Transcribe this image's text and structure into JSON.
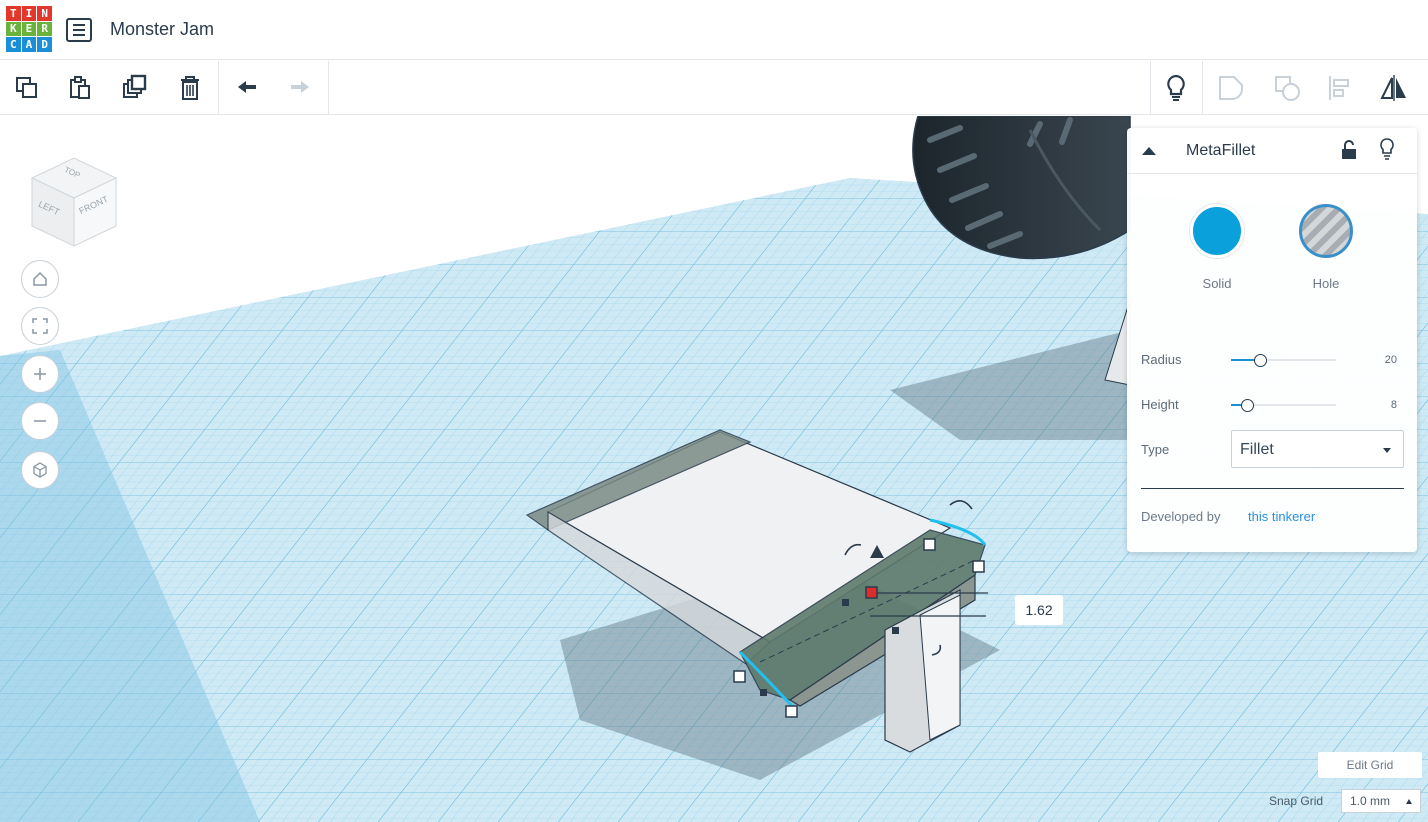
{
  "app": {
    "logo_letters": [
      "T",
      "I",
      "N",
      "K",
      "E",
      "R",
      "C",
      "A",
      "D"
    ],
    "logo_colors": [
      "#e2372b",
      "#e2372b",
      "#e2372b",
      "#69b33c",
      "#69b33c",
      "#69b33c",
      "#1a8fd8",
      "#1a8fd8",
      "#1a8fd8"
    ],
    "design_title": "Monster Jam"
  },
  "toolbar": {
    "left_icons": [
      "copy-icon",
      "paste-icon",
      "duplicate-icon",
      "delete-icon",
      "undo-icon",
      "redo-icon"
    ],
    "right_icons": [
      "lightbulb-icon",
      "group-icon",
      "ungroup-icon",
      "align-icon",
      "mirror-icon"
    ]
  },
  "viewcube": {
    "top": "TOP",
    "left": "LEFT",
    "front": "FRONT"
  },
  "nav_icons": [
    "home-icon",
    "fit-view-icon",
    "zoom-in-icon",
    "zoom-out-icon",
    "perspective-icon"
  ],
  "inspector": {
    "title": "MetaFillet",
    "solid_label": "Solid",
    "hole_label": "Hole",
    "solid_color": "#0aa0dc",
    "radius_label": "Radius",
    "radius_value": "20",
    "radius_level": 0.25,
    "height_label": "Height",
    "height_value": "8",
    "height_level": 0.12,
    "type_label": "Type",
    "type_value": "Fillet",
    "developed_by": "Developed by",
    "developer_link": "this tinkerer"
  },
  "dimension_label": "1.62",
  "grid": {
    "edit_grid_label": "Edit Grid",
    "snap_grid_label": "Snap Grid",
    "snap_grid_value": "1.0 mm"
  }
}
